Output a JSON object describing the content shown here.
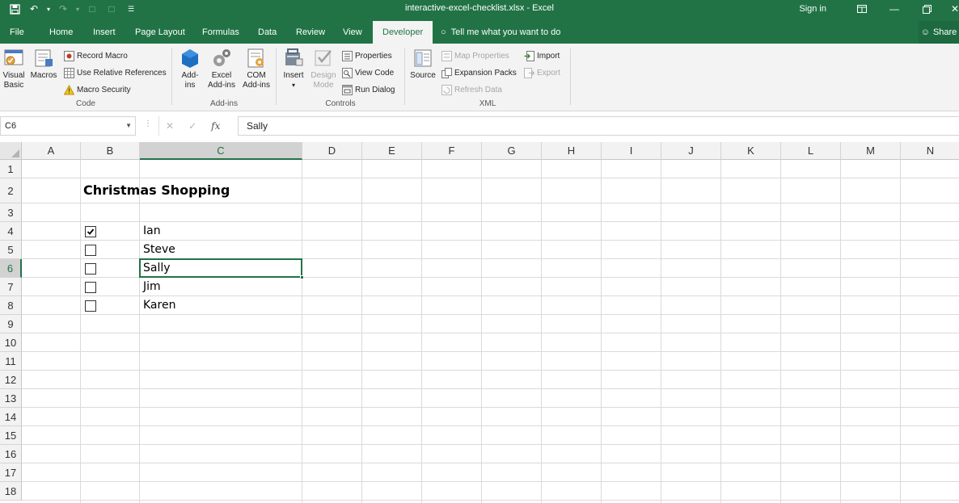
{
  "window": {
    "title": "interactive-excel-checklist.xlsx - Excel",
    "sign_in": "Sign in",
    "share": "Share"
  },
  "tabs": [
    "File",
    "Home",
    "Insert",
    "Page Layout",
    "Formulas",
    "Data",
    "Review",
    "View",
    "Developer"
  ],
  "active_tab": "Developer",
  "tell_me": "Tell me what you want to do",
  "ribbon": {
    "code": {
      "label": "Code",
      "visual_basic": "Visual Basic",
      "macros": "Macros",
      "record_macro": "Record Macro",
      "relative_refs": "Use Relative References",
      "macro_security": "Macro Security"
    },
    "addins": {
      "label": "Add-ins",
      "add_ins": "Add-ins",
      "excel_add_ins": "Excel Add-ins",
      "com_add_ins": "COM Add-ins"
    },
    "controls": {
      "label": "Controls",
      "insert": "Insert",
      "design_mode": "Design Mode",
      "properties": "Properties",
      "view_code": "View Code",
      "run_dialog": "Run Dialog"
    },
    "xml": {
      "label": "XML",
      "source": "Source",
      "map_properties": "Map Properties",
      "expansion_packs": "Expansion Packs",
      "refresh_data": "Refresh Data",
      "import": "Import",
      "export": "Export"
    }
  },
  "formula_bar": {
    "name_box": "C6",
    "value": "Sally"
  },
  "columns": [
    "A",
    "B",
    "C",
    "D",
    "E",
    "F",
    "G",
    "H",
    "I",
    "J",
    "K",
    "L",
    "M",
    "N"
  ],
  "selected_column": "C",
  "rows": [
    "1",
    "2",
    "3",
    "4",
    "5",
    "6",
    "7",
    "8",
    "9",
    "10",
    "11",
    "12",
    "13",
    "14",
    "15",
    "16",
    "17",
    "18"
  ],
  "selected_row": "6",
  "sheet": {
    "title": "Christmas Shopping",
    "items": [
      {
        "name": "Ian",
        "checked": true
      },
      {
        "name": "Steve",
        "checked": false
      },
      {
        "name": "Sally",
        "checked": false
      },
      {
        "name": "Jim",
        "checked": false
      },
      {
        "name": "Karen",
        "checked": false
      }
    ]
  }
}
